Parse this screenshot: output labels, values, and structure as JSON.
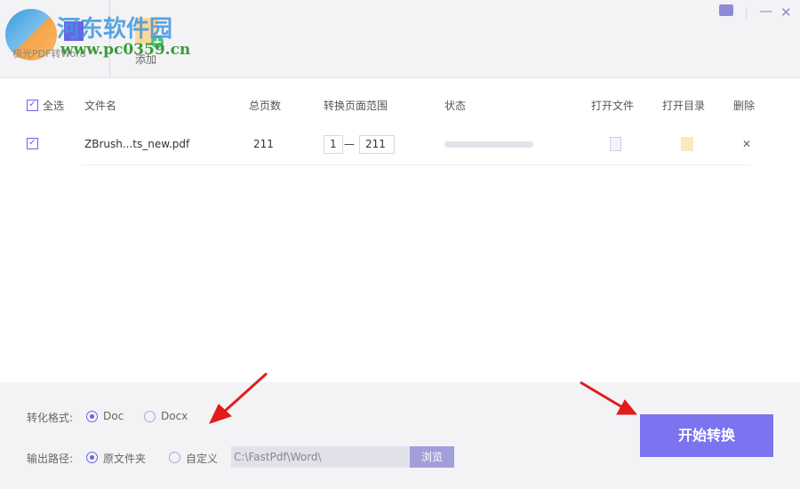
{
  "app": {
    "logo_text": "极光PDF转Word",
    "add_label": "添加"
  },
  "watermark": {
    "title": "河东软件园",
    "url": "www.pc0359.cn"
  },
  "window": {
    "feedback": "feedback-icon",
    "minimize": "—",
    "close": "✕"
  },
  "table": {
    "headers": {
      "select_all": "全选",
      "filename": "文件名",
      "pages": "总页数",
      "range": "转换页面范围",
      "status": "状态",
      "open_file": "打开文件",
      "open_dir": "打开目录",
      "delete": "删除"
    },
    "rows": [
      {
        "checked": true,
        "filename": "ZBrush...ts_new.pdf",
        "pages": "211",
        "range_from": "1",
        "range_sep": "—",
        "range_to": "211",
        "progress": 0,
        "delete": "✕"
      }
    ]
  },
  "options": {
    "format_label": "转化格式:",
    "format_options": [
      "Doc",
      "Docx"
    ],
    "format_selected": "Doc",
    "output_label": "输出路径:",
    "output_options": [
      "原文件夹",
      "自定义"
    ],
    "output_selected": "原文件夹",
    "path_value": "C:\\FastPdf\\Word\\",
    "browse": "浏览"
  },
  "start_button": "开始转换",
  "colors": {
    "accent": "#6a63e8",
    "button": "#7b73f0",
    "arrow": "#e31b1b"
  }
}
